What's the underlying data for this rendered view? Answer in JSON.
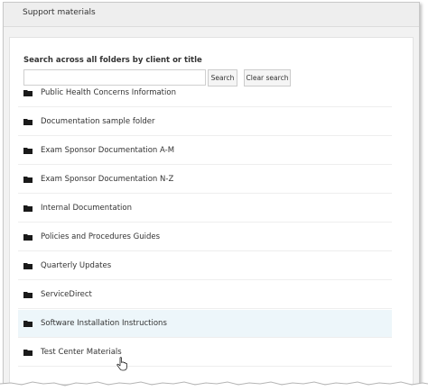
{
  "header": {
    "title": "Support materials"
  },
  "search": {
    "label": "Search across all folders by client or title",
    "placeholder": "",
    "value": "",
    "search_button": "Search",
    "clear_button": "Clear search"
  },
  "folders": [
    {
      "label": "Public Health Concerns Information"
    },
    {
      "label": "Documentation sample folder"
    },
    {
      "label": "Exam Sponsor Documentation A-M"
    },
    {
      "label": "Exam Sponsor Documentation N-Z"
    },
    {
      "label": "Internal Documentation"
    },
    {
      "label": "Policies and Procedures Guides"
    },
    {
      "label": "Quarterly Updates"
    },
    {
      "label": "ServiceDirect"
    },
    {
      "label": "Software Installation Instructions"
    },
    {
      "label": "Test Center Materials"
    }
  ],
  "colors": {
    "hover_row": "#edf6fa",
    "header_bg": "#eeeeee",
    "text": "#333333"
  },
  "icons": {
    "folder": "folder-icon",
    "cursor": "hand-pointer-icon"
  }
}
